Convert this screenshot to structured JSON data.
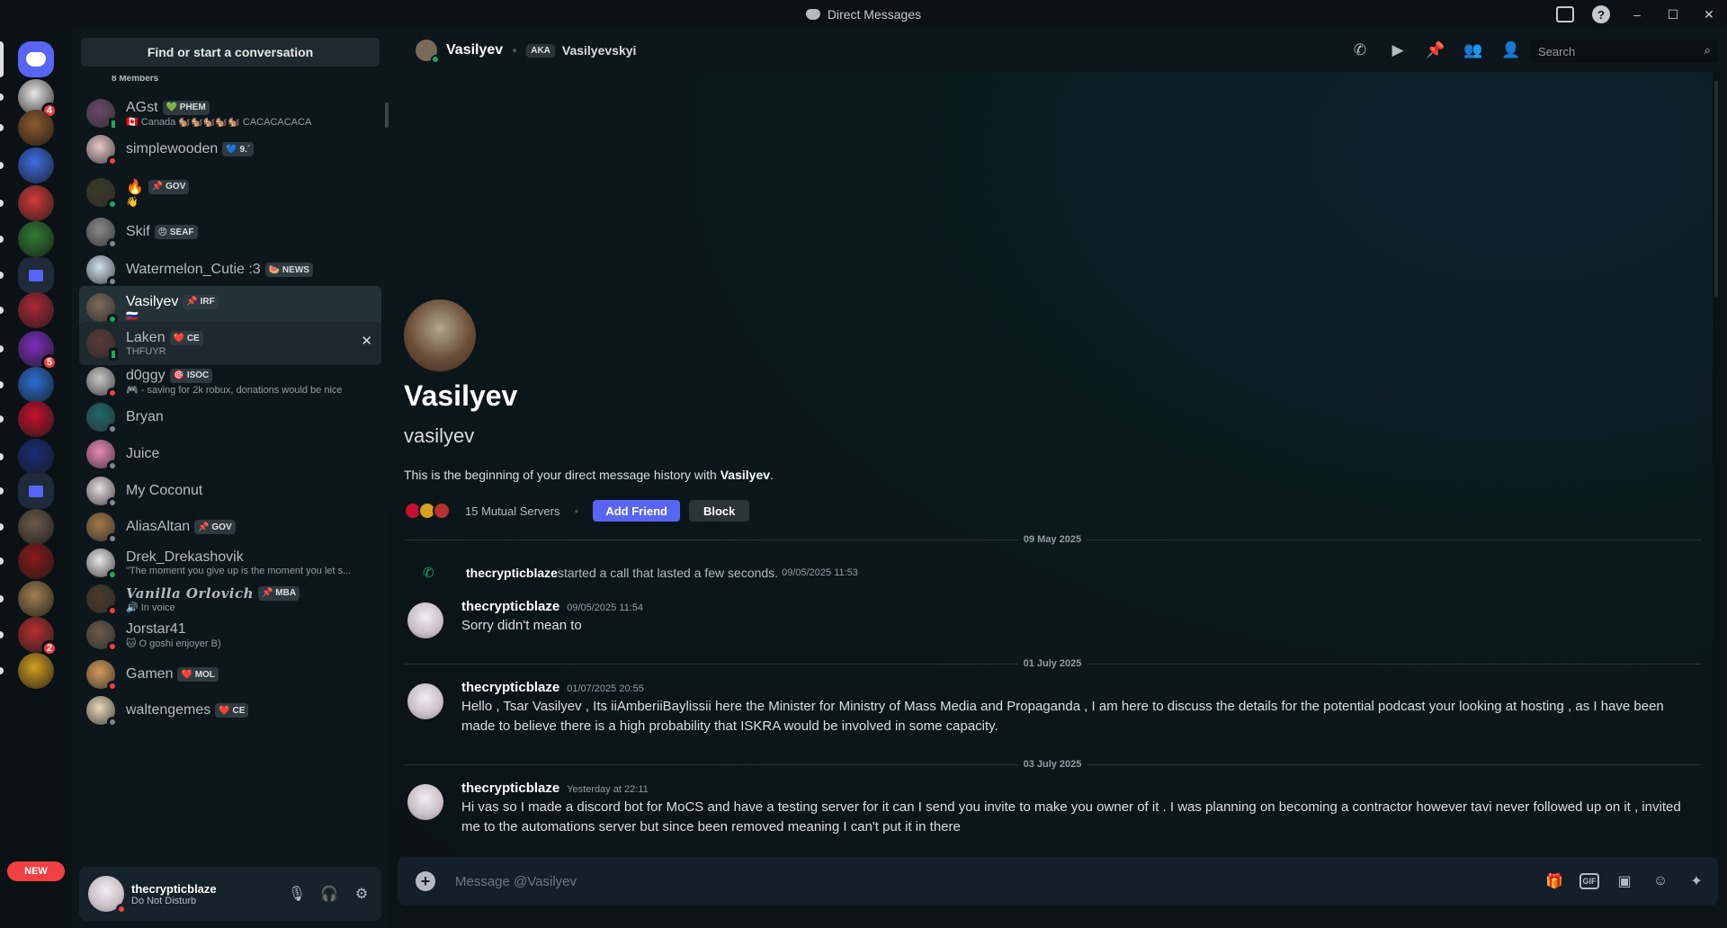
{
  "window": {
    "title": "Direct Messages",
    "controls": {
      "minimize": "–",
      "maximize": "☐",
      "close": "✕"
    }
  },
  "rail": {
    "servers": [
      {
        "name": "home",
        "color": "#5865f2",
        "badge": "",
        "active": true
      },
      {
        "name": "server-1",
        "color": "#e8e8e8",
        "badge": "4"
      },
      {
        "name": "server-2",
        "color": "#8b5a2b",
        "badge": ""
      },
      {
        "name": "server-3",
        "color": "#3d6ee8",
        "badge": ""
      },
      {
        "name": "server-4",
        "color": "#d63a3a",
        "badge": ""
      },
      {
        "name": "server-5",
        "color": "#2e7d32",
        "badge": ""
      },
      {
        "name": "folder-1",
        "color": "#5865f2",
        "badge": ""
      },
      {
        "name": "server-6",
        "color": "#b0283a",
        "badge": ""
      },
      {
        "name": "server-7",
        "color": "#7b2fbf",
        "badge": "5"
      },
      {
        "name": "server-8",
        "color": "#2a6fd6",
        "badge": ""
      },
      {
        "name": "server-9",
        "color": "#c8102e",
        "badge": ""
      },
      {
        "name": "server-10",
        "color": "#1a2b7a",
        "badge": ""
      },
      {
        "name": "folder-2",
        "color": "#5865f2",
        "badge": ""
      },
      {
        "name": "server-11",
        "color": "#6b5a4a",
        "badge": ""
      },
      {
        "name": "server-12",
        "color": "#8b1a1a",
        "badge": ""
      },
      {
        "name": "server-13",
        "color": "#a08050",
        "badge": ""
      },
      {
        "name": "server-14",
        "color": "#b83030",
        "badge": "2"
      },
      {
        "name": "server-15",
        "color": "#d4a020",
        "badge": ""
      }
    ],
    "new_label": "NEW"
  },
  "sidebar": {
    "find_label": "Find or start a conversation",
    "partial_top": "8 Members",
    "dms": [
      {
        "name": "AGst",
        "tag": "💚 PHEM",
        "sub": "🇨🇦 Canada 🐿️🐿️🐿️🐿️🐿️ CACACACACA",
        "status": "mobile",
        "avatar": "#6a4a6a"
      },
      {
        "name": "simplewooden",
        "tag": "💙 9.´",
        "sub": "",
        "status": "dnd",
        "avatar": "#e8c8c8"
      },
      {
        "name": "🔥",
        "tag": "📌 GOV",
        "sub": "👋",
        "status": "online",
        "avatar": "#3a3a2a"
      },
      {
        "name": "Skif",
        "tag": "😠 SEAF",
        "sub": "",
        "status": "offline",
        "avatar": "#8a8a8a"
      },
      {
        "name": "Watermelon_Cutie :3",
        "tag": "🍉 NEWS",
        "sub": "",
        "status": "offline",
        "avatar": "#cfe3ef"
      },
      {
        "name": "Vasilyev",
        "tag": "📌 IRF",
        "sub": "🇷🇺",
        "status": "online",
        "avatar": "#7a6a5a"
      },
      {
        "name": "Laken",
        "tag": "❤️ CE",
        "sub": "THFUYR",
        "status": "mobile",
        "avatar": "#5a3a3a"
      },
      {
        "name": "d0ggy",
        "tag": "🎯 ISOC",
        "sub": "🎮 - saving for 2k robux, donations would be nice",
        "status": "dnd",
        "avatar": "#c8c8c8"
      },
      {
        "name": "Bryan",
        "tag": "",
        "sub": "",
        "status": "offline",
        "avatar": "#1e6a6a"
      },
      {
        "name": "Juice",
        "tag": "",
        "sub": "",
        "status": "offline",
        "avatar": "#e88ab8"
      },
      {
        "name": "My Coconut",
        "tag": "",
        "sub": "",
        "status": "offline",
        "avatar": "#e8dde0"
      },
      {
        "name": "AliasAltan",
        "tag": "📌 GOV",
        "sub": "",
        "status": "offline",
        "avatar": "#a07848"
      },
      {
        "name": "Drek_Drekashovik",
        "tag": "",
        "sub": "\"The moment you give up is the moment you let s...",
        "status": "online",
        "avatar": "#e8e8e8"
      },
      {
        "name": "Vanilla Orlovich",
        "tag": "📌 MBA",
        "sub": "🔊 In voice",
        "status": "dnd",
        "avatar": "#4a3a2a"
      },
      {
        "name": "Jorstar41",
        "tag": "",
        "sub": "🐱 O goshi enjoyer B)",
        "status": "dnd",
        "avatar": "#6a5a4a"
      },
      {
        "name": "Gamen",
        "tag": "❤️ MOL",
        "sub": "",
        "status": "dnd",
        "avatar": "#d49a5a"
      },
      {
        "name": "waltengemes",
        "tag": "❤️ CE",
        "sub": "",
        "status": "offline",
        "avatar": "#e8d8b8"
      }
    ]
  },
  "user_panel": {
    "name": "thecrypticblaze",
    "status": "Do Not Disturb",
    "mic": "🎙",
    "headset": "🎧",
    "settings": "⚙"
  },
  "header": {
    "name": "Vasilyev",
    "aka_label": "AKA",
    "aka_name": "Vasilyevskyi",
    "search_placeholder": "Search"
  },
  "intro": {
    "title": "Vasilyev",
    "username": "vasilyev",
    "desc_prefix": "This is the beginning of your direct message history with ",
    "desc_name": "Vasilyev",
    "desc_suffix": ".",
    "mutual": "15 Mutual Servers",
    "add_friend": "Add Friend",
    "block": "Block"
  },
  "messages": {
    "date1": "09 May 2025",
    "call": {
      "author": "thecrypticblaze",
      "text": " started a call that lasted a few seconds.",
      "ts": "09/05/2025 11:53"
    },
    "m1": {
      "author": "thecrypticblaze",
      "ts": "09/05/2025 11:54",
      "body": "Sorry didn't mean to"
    },
    "date2": "01 July 2025",
    "m2": {
      "author": "thecrypticblaze",
      "ts": "01/07/2025 20:55",
      "body": "Hello , Tsar Vasilyev , Its iiAmberiiBaylissii here the Minister for Ministry of Mass Media and Propaganda , I am here to discuss the details for the potential podcast your looking at hosting , as I have been made to believe there is a high probability that ISKRA would be involved in some capacity."
    },
    "date3": "03 July 2025",
    "m3": {
      "author": "thecrypticblaze",
      "ts": "Yesterday at 22:11",
      "body": "Hi vas so I made a discord bot for MoCS and have a testing server for it can I send you invite to make you owner of it . I was planning on becoming a contractor however tavi never followed up on it , invited me to the automations server but since been removed meaning I can't put it in there"
    }
  },
  "composer": {
    "placeholder": "Message @Vasilyev",
    "gif": "GIF"
  }
}
